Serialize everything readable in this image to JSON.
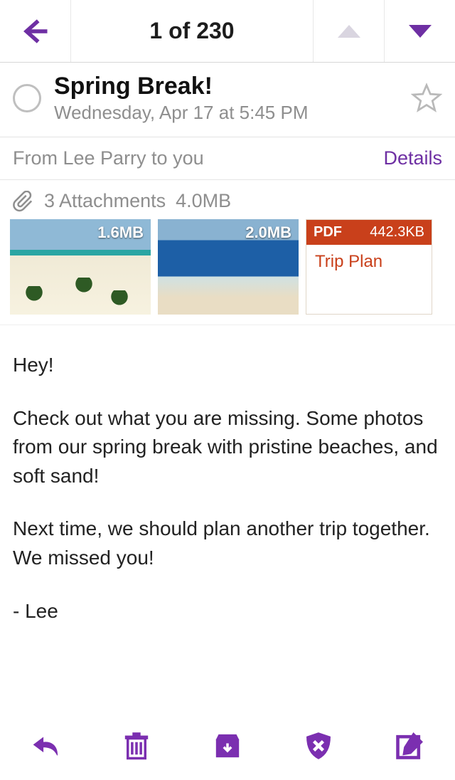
{
  "nav": {
    "position_label": "1 of 230"
  },
  "message": {
    "subject": "Spring Break!",
    "timestamp": "Wednesday, Apr 17 at 5:45 PM",
    "from_line": "From Lee Parry to you",
    "details_label": "Details"
  },
  "attachments": {
    "count_label": "3 Attachments",
    "total_size": "4.0MB",
    "items": [
      {
        "kind": "image",
        "size": "1.6MB"
      },
      {
        "kind": "image",
        "size": "2.0MB"
      },
      {
        "kind": "pdf",
        "badge": "PDF",
        "size": "442.3KB",
        "title": "Trip Plan"
      }
    ]
  },
  "body": {
    "p1": "Hey!",
    "p2": "Check out what you are missing. Some photos from our spring break with pristine beaches, and soft sand!",
    "p3": "Next time, we should plan another trip together. We missed you!",
    "p4": "- Lee"
  },
  "icons": {
    "back": "back-arrow-icon",
    "prev": "chevron-up-icon",
    "next": "chevron-down-icon",
    "select": "select-circle-icon",
    "star": "star-icon",
    "clip": "paperclip-icon",
    "reply": "reply-icon",
    "trash": "trash-icon",
    "archive": "archive-icon",
    "spam": "shield-x-icon",
    "compose": "compose-icon"
  }
}
